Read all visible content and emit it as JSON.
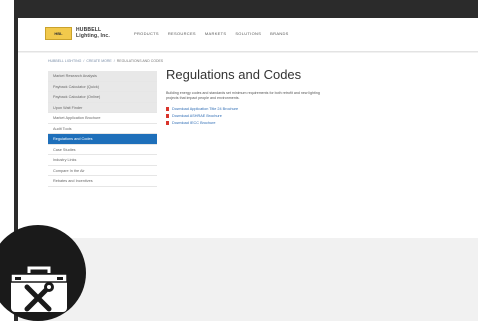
{
  "header": {
    "logo_badge": "HBL",
    "brand_line1": "HUBBELL",
    "brand_line2": "Lighting, Inc.",
    "nav": [
      "PRODUCTS",
      "RESOURCES",
      "MARKETS",
      "SOLUTIONS",
      "BRANDS"
    ]
  },
  "breadcrumb": [
    "HUBBELL LIGHTING",
    "/",
    "CREATE MORE",
    "/",
    "REGULATIONS AND CODES"
  ],
  "sidebar": {
    "items": [
      {
        "label": "Market Research Analysis",
        "state": "shaded"
      },
      {
        "label": "Payback Calculator (Quick)",
        "state": "shaded"
      },
      {
        "label": "Payback Calculator (Online)",
        "state": "shaded"
      },
      {
        "label": "Upon Wait Finder",
        "state": "shaded"
      },
      {
        "label": "Market Application Brochure",
        "state": "normal"
      },
      {
        "label": "Audit Tools",
        "state": "normal"
      },
      {
        "label": "Regulations and Codes",
        "state": "active"
      },
      {
        "label": "Case Studies",
        "state": "normal"
      },
      {
        "label": "Industry Links",
        "state": "normal"
      },
      {
        "label": "Compare In the Air",
        "state": "normal"
      },
      {
        "label": "Rebates and Incentives",
        "state": "normal"
      }
    ]
  },
  "main": {
    "title": "Regulations and Codes",
    "intro": "Building energy codes and standards set minimum requirements for both retrofit and new lighting projects that impact people and environments.",
    "links": [
      "Download Application Title 24 Brochure",
      "Download ASHRAE Brochure",
      "Download IECC Brochure"
    ]
  },
  "colors": {
    "active_nav": "#1e6fba",
    "link": "#2f6db5",
    "pdf_icon": "#d9342b",
    "frame": "#2b2b2b",
    "logo": "#f2c94c"
  },
  "icons": {
    "badge": "toolbox-icon"
  }
}
